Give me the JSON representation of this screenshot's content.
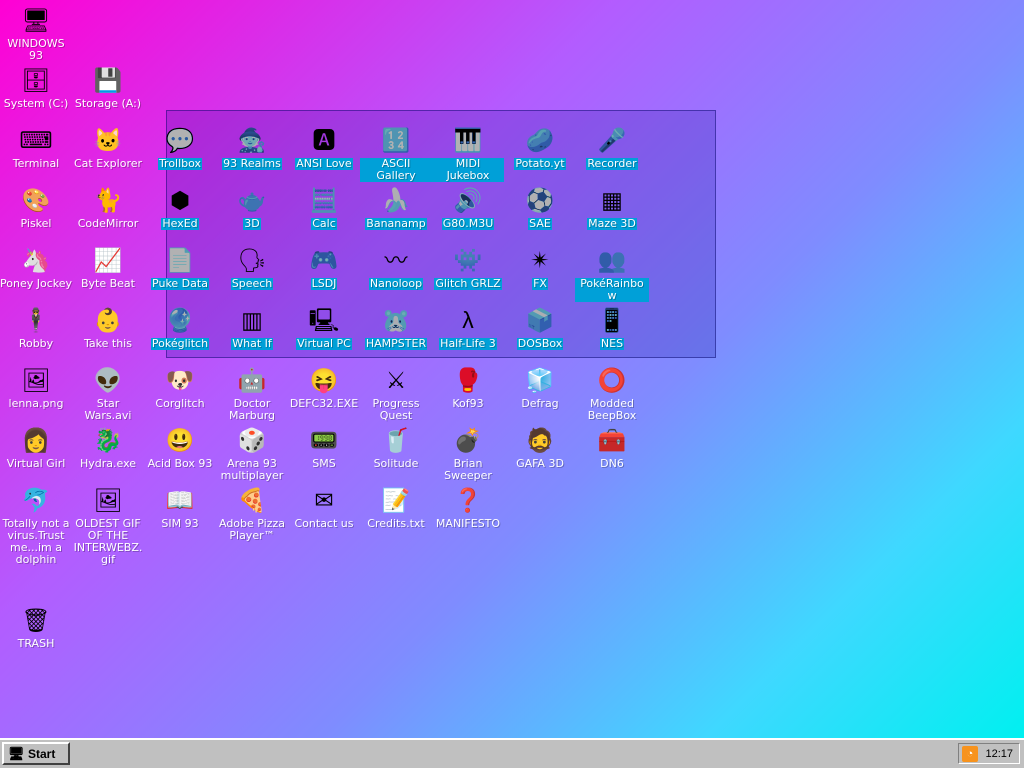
{
  "desktop": {
    "icons": [
      {
        "label": "WINDOWS 93",
        "glyph": "🖥",
        "name": "icon-windows93",
        "selected": false
      },
      {
        "label": "System (C:)",
        "glyph": "🗄",
        "name": "icon-system-c",
        "selected": false
      },
      {
        "label": "Storage (A:)",
        "glyph": "💾",
        "name": "icon-storage-a",
        "selected": false
      },
      {
        "label": "Terminal",
        "glyph": "⌨",
        "name": "icon-terminal",
        "selected": false
      },
      {
        "label": "Cat Explorer",
        "glyph": "🐱",
        "name": "icon-cat-explorer",
        "selected": false
      },
      {
        "label": "Trollbox",
        "glyph": "💬",
        "name": "icon-trollbox",
        "selected": true
      },
      {
        "label": "93 Realms",
        "glyph": "🧙",
        "name": "icon-93-realms",
        "selected": true
      },
      {
        "label": "ANSI Love",
        "glyph": "🅰",
        "name": "icon-ansi-love",
        "selected": true
      },
      {
        "label": "ASCII Gallery",
        "glyph": "🔢",
        "name": "icon-ascii-gallery",
        "selected": true
      },
      {
        "label": "MIDI Jukebox",
        "glyph": "🎹",
        "name": "icon-midi-jukebox",
        "selected": true
      },
      {
        "label": "Potato.yt",
        "glyph": "🥔",
        "name": "icon-potato-yt",
        "selected": true
      },
      {
        "label": "Recorder",
        "glyph": "🎤",
        "name": "icon-recorder",
        "selected": true
      },
      {
        "label": "Piskel",
        "glyph": "🎨",
        "name": "icon-piskel",
        "selected": false
      },
      {
        "label": "CodeMirror",
        "glyph": "🐈",
        "name": "icon-codemirror",
        "selected": false
      },
      {
        "label": "HexEd",
        "glyph": "⬢",
        "name": "icon-hexed",
        "selected": true
      },
      {
        "label": "3D",
        "glyph": "🫖",
        "name": "icon-3d",
        "selected": true
      },
      {
        "label": "Calc",
        "glyph": "🧮",
        "name": "icon-calc",
        "selected": true
      },
      {
        "label": "Bananamp",
        "glyph": "🍌",
        "name": "icon-bananamp",
        "selected": true
      },
      {
        "label": "G80.M3U",
        "glyph": "🔊",
        "name": "icon-g80-m3u",
        "selected": true
      },
      {
        "label": "SAE",
        "glyph": "⚽",
        "name": "icon-sae",
        "selected": true
      },
      {
        "label": "Maze 3D",
        "glyph": "▦",
        "name": "icon-maze-3d",
        "selected": true
      },
      {
        "label": "Poney Jockey",
        "glyph": "🦄",
        "name": "icon-poney-jockey",
        "selected": false
      },
      {
        "label": "Byte Beat",
        "glyph": "📈",
        "name": "icon-byte-beat",
        "selected": false
      },
      {
        "label": "Puke Data",
        "glyph": "📄",
        "name": "icon-puke-data",
        "selected": true
      },
      {
        "label": "Speech",
        "glyph": "🗣",
        "name": "icon-speech",
        "selected": true
      },
      {
        "label": "LSDJ",
        "glyph": "🎮",
        "name": "icon-lsdj",
        "selected": true
      },
      {
        "label": "Nanoloop",
        "glyph": "〰",
        "name": "icon-nanoloop",
        "selected": true
      },
      {
        "label": "Glitch GRLZ",
        "glyph": "👾",
        "name": "icon-glitch-grlz",
        "selected": true
      },
      {
        "label": "FX",
        "glyph": "✴",
        "name": "icon-fx",
        "selected": true
      },
      {
        "label": "PokéRainbow",
        "glyph": "👥",
        "name": "icon-pokerainbow",
        "selected": true
      },
      {
        "label": "Robby",
        "glyph": "🕴",
        "name": "icon-robby",
        "selected": false
      },
      {
        "label": "Take this",
        "glyph": "👶",
        "name": "icon-take-this",
        "selected": false
      },
      {
        "label": "Pokéglitch",
        "glyph": "🔮",
        "name": "icon-pokeglitch",
        "selected": true
      },
      {
        "label": "What If",
        "glyph": "▥",
        "name": "icon-what-if",
        "selected": true
      },
      {
        "label": "Virtual PC",
        "glyph": "🖳",
        "name": "icon-virtual-pc",
        "selected": true
      },
      {
        "label": "HAMPSTER",
        "glyph": "🐹",
        "name": "icon-hampster",
        "selected": true
      },
      {
        "label": "Half-Life 3",
        "glyph": "λ",
        "name": "icon-half-life-3",
        "selected": true
      },
      {
        "label": "DOSBox",
        "glyph": "📦",
        "name": "icon-dosbox",
        "selected": true
      },
      {
        "label": "NES",
        "glyph": "📱",
        "name": "icon-nes",
        "selected": true
      },
      {
        "label": "lenna.png",
        "glyph": "🖼",
        "name": "icon-lenna-png",
        "selected": false
      },
      {
        "label": "Star Wars.avi",
        "glyph": "👽",
        "name": "icon-star-wars-avi",
        "selected": false
      },
      {
        "label": "Corglitch",
        "glyph": "🐶",
        "name": "icon-corglitch",
        "selected": false
      },
      {
        "label": "Doctor Marburg",
        "glyph": "🤖",
        "name": "icon-doctor-marburg",
        "selected": false
      },
      {
        "label": "DEFC32.EXE",
        "glyph": "😝",
        "name": "icon-defc32-exe",
        "selected": false
      },
      {
        "label": "Progress Quest",
        "glyph": "⚔",
        "name": "icon-progress-quest",
        "selected": false
      },
      {
        "label": "Kof93",
        "glyph": "🥊",
        "name": "icon-kof93",
        "selected": false
      },
      {
        "label": "Defrag",
        "glyph": "🧊",
        "name": "icon-defrag",
        "selected": false
      },
      {
        "label": "Modded BeepBox",
        "glyph": "⭕",
        "name": "icon-modded-beepbox",
        "selected": false
      },
      {
        "label": "Virtual Girl",
        "glyph": "👩",
        "name": "icon-virtual-girl",
        "selected": false
      },
      {
        "label": "Hydra.exe",
        "glyph": "🐉",
        "name": "icon-hydra-exe",
        "selected": false
      },
      {
        "label": "Acid Box 93",
        "glyph": "😃",
        "name": "icon-acid-box-93",
        "selected": false
      },
      {
        "label": "Arena 93 multiplayer",
        "glyph": "🎲",
        "name": "icon-arena-93",
        "selected": false
      },
      {
        "label": "SMS",
        "glyph": "📟",
        "name": "icon-sms",
        "selected": false
      },
      {
        "label": "Solitude",
        "glyph": "🥤",
        "name": "icon-solitude",
        "selected": false
      },
      {
        "label": "Brian Sweeper",
        "glyph": "💣",
        "name": "icon-brian-sweeper",
        "selected": false
      },
      {
        "label": "GAFA 3D",
        "glyph": "🧔",
        "name": "icon-gafa-3d",
        "selected": false
      },
      {
        "label": "DN6",
        "glyph": "🧰",
        "name": "icon-dn6",
        "selected": false
      },
      {
        "label": "Totally not a virus.Trust me...im a dolphin",
        "glyph": "🐬",
        "name": "icon-dolphin",
        "selected": false
      },
      {
        "label": "OLDEST GIF OF THE INTERWEBZ.gif",
        "glyph": "🖼",
        "name": "icon-oldest-gif",
        "selected": false
      },
      {
        "label": "SIM 93",
        "glyph": "📖",
        "name": "icon-sim-93",
        "selected": false
      },
      {
        "label": "Adobe Pizza Player™",
        "glyph": "🍕",
        "name": "icon-adobe-pizza-player",
        "selected": false
      },
      {
        "label": "Contact us",
        "glyph": "✉",
        "name": "icon-contact-us",
        "selected": false
      },
      {
        "label": "Credits.txt",
        "glyph": "📝",
        "name": "icon-credits-txt",
        "selected": false
      },
      {
        "label": "MANIFESTO",
        "glyph": "❓",
        "name": "icon-manifesto",
        "selected": false
      },
      {
        "label": "TRASH",
        "glyph": "🗑",
        "name": "icon-trash",
        "selected": false
      }
    ]
  },
  "taskbar": {
    "start_label": "Start",
    "start_glyph": "🖥",
    "tray_glyph": "◔",
    "clock": "12:17"
  }
}
